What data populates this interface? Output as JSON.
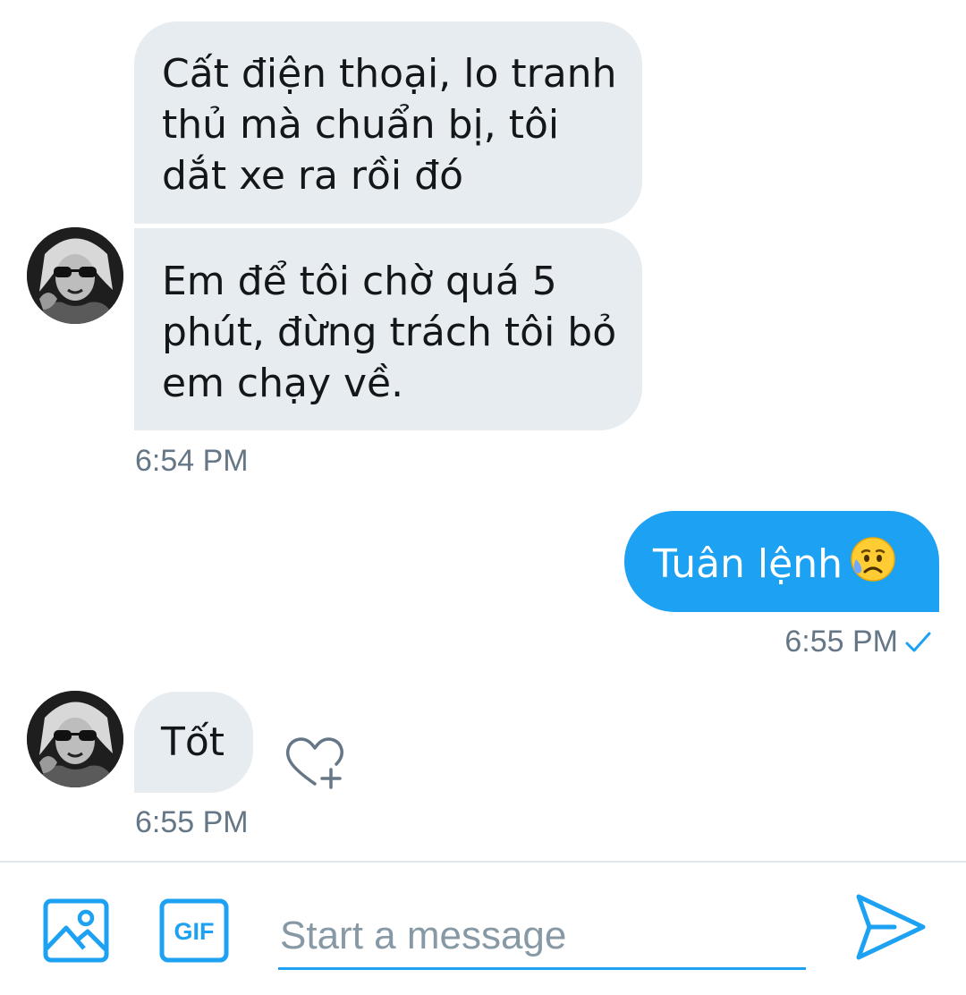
{
  "messages": [
    {
      "direction": "incoming",
      "text": "Cất điện thoại, lo tranh thủ mà chuẩn bị, tôi dắt xe ra rồi đó"
    },
    {
      "direction": "incoming",
      "text": "Em để tôi chờ quá 5 phút, đừng trách tôi bỏ em chạy về.",
      "timestamp": "6:54 PM"
    },
    {
      "direction": "outgoing",
      "text": "Tuân lệnh",
      "emoji": "sad-sweat-emoji",
      "timestamp": "6:55 PM",
      "status": "sent-check"
    },
    {
      "direction": "incoming",
      "text": "Tốt",
      "timestamp": "6:55 PM"
    }
  ],
  "composer": {
    "placeholder": "Start a message",
    "gif_label": "GIF"
  },
  "colors": {
    "incoming_bubble": "#e6ecf0",
    "outgoing_bubble": "#1da1f2",
    "accent": "#1da1f2",
    "timestamp": "#657786"
  }
}
